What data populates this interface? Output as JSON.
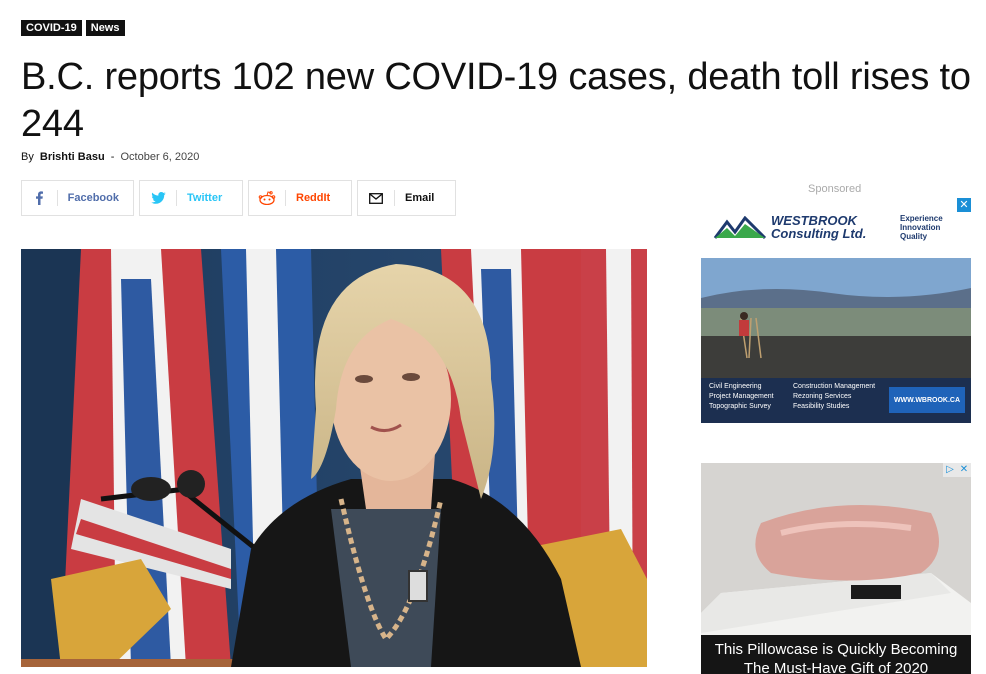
{
  "tags": [
    "COVID-19",
    "News"
  ],
  "article": {
    "title": "B.C. reports 102 new COVID-19 cases, death toll rises to 244",
    "by_label": "By",
    "author": "Brishti Basu",
    "separator": "-",
    "date": "October 6, 2020"
  },
  "share": {
    "facebook": "Facebook",
    "twitter": "Twitter",
    "reddit": "ReddIt",
    "email": "Email"
  },
  "sidebar": {
    "sponsored": "Sponsored",
    "ad1": {
      "brand_line1": "WESTBROOK",
      "brand_line2": "Consulting Ltd.",
      "tagline_1": "Experience",
      "tagline_2": "Innovation",
      "tagline_3": "Quality",
      "services_left": [
        "Civil Engineering",
        "Project Management",
        "Topographic Survey"
      ],
      "services_right": [
        "Construction Management",
        "Rezoning Services",
        "Feasibility Studies"
      ],
      "cta": "WWW.WBROOK.CA"
    },
    "ad2": {
      "caption": "This Pillowcase is Quickly Becoming The Must-Have Gift of 2020"
    }
  },
  "colors": {
    "facebook": "#516eab",
    "twitter": "#29c5f6",
    "reddit": "#ff4500",
    "tag_bg": "#111111"
  }
}
